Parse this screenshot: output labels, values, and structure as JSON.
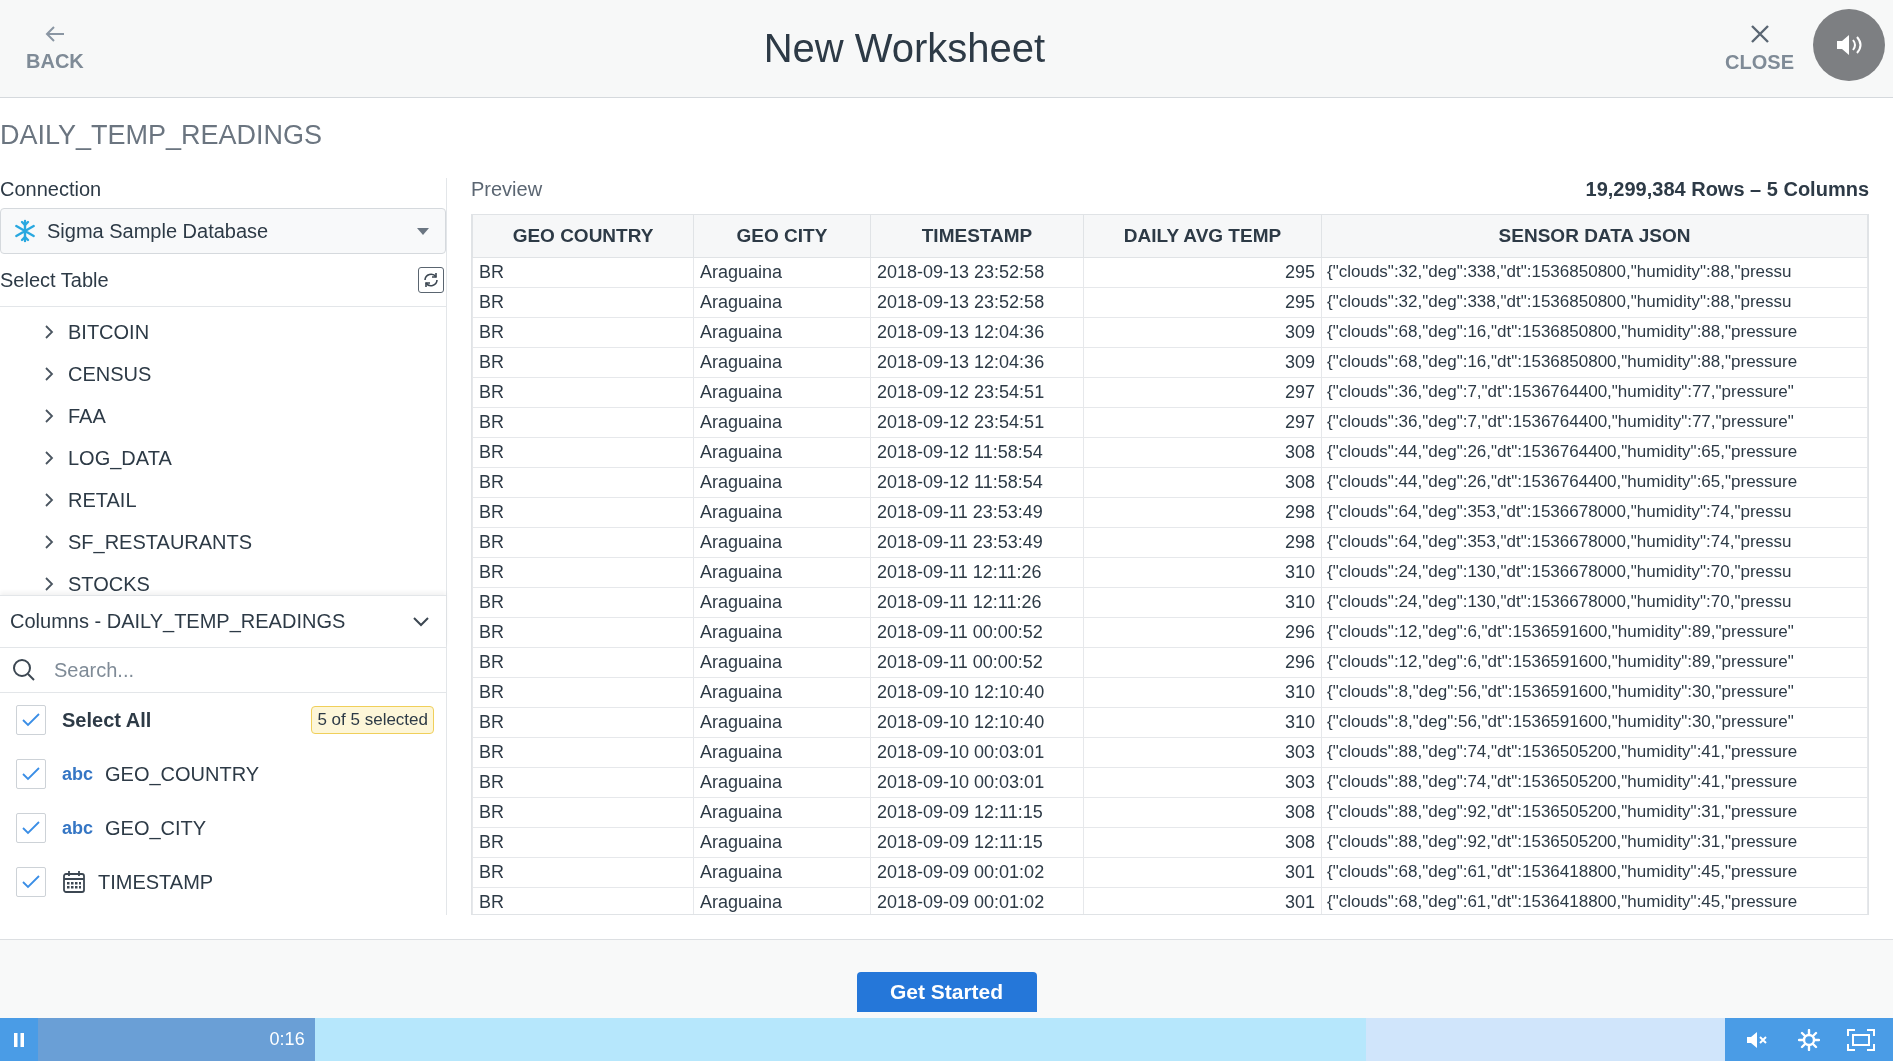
{
  "header": {
    "back_label": "BACK",
    "title": "New Worksheet",
    "close_label": "CLOSE"
  },
  "table_name": "DAILY_TEMP_READINGS",
  "connection": {
    "label": "Connection",
    "value": "Sigma Sample Database"
  },
  "select_table": {
    "label": "Select Table",
    "items": [
      {
        "label": "BITCOIN",
        "expanded": false
      },
      {
        "label": "CENSUS",
        "expanded": false
      },
      {
        "label": "FAA",
        "expanded": false
      },
      {
        "label": "LOG_DATA",
        "expanded": false
      },
      {
        "label": "RETAIL",
        "expanded": false
      },
      {
        "label": "SF_RESTAURANTS",
        "expanded": false
      },
      {
        "label": "STOCKS",
        "expanded": false
      }
    ]
  },
  "columns_panel": {
    "title": "Columns - DAILY_TEMP_READINGS",
    "expanded": true,
    "search": {
      "placeholder": "Search..."
    },
    "select_all": {
      "label": "Select All",
      "checked": true,
      "badge": "5 of 5 selected"
    },
    "items": [
      {
        "kind": "text",
        "type_label": "abc",
        "label": "GEO_COUNTRY",
        "checked": true
      },
      {
        "kind": "text",
        "type_label": "abc",
        "label": "GEO_CITY",
        "checked": true
      },
      {
        "kind": "datetime",
        "label": "TIMESTAMP",
        "checked": true
      }
    ]
  },
  "preview": {
    "label": "Preview",
    "summary": "19,299,384 Rows – 5 Columns",
    "columns": [
      "GEO COUNTRY",
      "GEO CITY",
      "TIMESTAMP",
      "DAILY AVG TEMP",
      "SENSOR DATA JSON"
    ],
    "rows": [
      [
        "BR",
        "Araguaina",
        "2018-09-13 23:52:58",
        "295",
        "{\"clouds\":32,\"deg\":338,\"dt\":1536850800,\"humidity\":88,\"pressu"
      ],
      [
        "BR",
        "Araguaina",
        "2018-09-13 23:52:58",
        "295",
        "{\"clouds\":32,\"deg\":338,\"dt\":1536850800,\"humidity\":88,\"pressu"
      ],
      [
        "BR",
        "Araguaina",
        "2018-09-13 12:04:36",
        "309",
        "{\"clouds\":68,\"deg\":16,\"dt\":1536850800,\"humidity\":88,\"pressure"
      ],
      [
        "BR",
        "Araguaina",
        "2018-09-13 12:04:36",
        "309",
        "{\"clouds\":68,\"deg\":16,\"dt\":1536850800,\"humidity\":88,\"pressure"
      ],
      [
        "BR",
        "Araguaina",
        "2018-09-12 23:54:51",
        "297",
        "{\"clouds\":36,\"deg\":7,\"dt\":1536764400,\"humidity\":77,\"pressure\""
      ],
      [
        "BR",
        "Araguaina",
        "2018-09-12 23:54:51",
        "297",
        "{\"clouds\":36,\"deg\":7,\"dt\":1536764400,\"humidity\":77,\"pressure\""
      ],
      [
        "BR",
        "Araguaina",
        "2018-09-12 11:58:54",
        "308",
        "{\"clouds\":44,\"deg\":26,\"dt\":1536764400,\"humidity\":65,\"pressure"
      ],
      [
        "BR",
        "Araguaina",
        "2018-09-12 11:58:54",
        "308",
        "{\"clouds\":44,\"deg\":26,\"dt\":1536764400,\"humidity\":65,\"pressure"
      ],
      [
        "BR",
        "Araguaina",
        "2018-09-11 23:53:49",
        "298",
        "{\"clouds\":64,\"deg\":353,\"dt\":1536678000,\"humidity\":74,\"pressu"
      ],
      [
        "BR",
        "Araguaina",
        "2018-09-11 23:53:49",
        "298",
        "{\"clouds\":64,\"deg\":353,\"dt\":1536678000,\"humidity\":74,\"pressu"
      ],
      [
        "BR",
        "Araguaina",
        "2018-09-11 12:11:26",
        "310",
        "{\"clouds\":24,\"deg\":130,\"dt\":1536678000,\"humidity\":70,\"pressu"
      ],
      [
        "BR",
        "Araguaina",
        "2018-09-11 12:11:26",
        "310",
        "{\"clouds\":24,\"deg\":130,\"dt\":1536678000,\"humidity\":70,\"pressu"
      ],
      [
        "BR",
        "Araguaina",
        "2018-09-11 00:00:52",
        "296",
        "{\"clouds\":12,\"deg\":6,\"dt\":1536591600,\"humidity\":89,\"pressure\""
      ],
      [
        "BR",
        "Araguaina",
        "2018-09-11 00:00:52",
        "296",
        "{\"clouds\":12,\"deg\":6,\"dt\":1536591600,\"humidity\":89,\"pressure\""
      ],
      [
        "BR",
        "Araguaina",
        "2018-09-10 12:10:40",
        "310",
        "{\"clouds\":8,\"deg\":56,\"dt\":1536591600,\"humidity\":30,\"pressure\""
      ],
      [
        "BR",
        "Araguaina",
        "2018-09-10 12:10:40",
        "310",
        "{\"clouds\":8,\"deg\":56,\"dt\":1536591600,\"humidity\":30,\"pressure\""
      ],
      [
        "BR",
        "Araguaina",
        "2018-09-10 00:03:01",
        "303",
        "{\"clouds\":88,\"deg\":74,\"dt\":1536505200,\"humidity\":41,\"pressure"
      ],
      [
        "BR",
        "Araguaina",
        "2018-09-10 00:03:01",
        "303",
        "{\"clouds\":88,\"deg\":74,\"dt\":1536505200,\"humidity\":41,\"pressure"
      ],
      [
        "BR",
        "Araguaina",
        "2018-09-09 12:11:15",
        "308",
        "{\"clouds\":88,\"deg\":92,\"dt\":1536505200,\"humidity\":31,\"pressure"
      ],
      [
        "BR",
        "Araguaina",
        "2018-09-09 12:11:15",
        "308",
        "{\"clouds\":88,\"deg\":92,\"dt\":1536505200,\"humidity\":31,\"pressure"
      ],
      [
        "BR",
        "Araguaina",
        "2018-09-09 00:01:02",
        "301",
        "{\"clouds\":68,\"deg\":61,\"dt\":1536418800,\"humidity\":45,\"pressure"
      ],
      [
        "BR",
        "Araguaina",
        "2018-09-09 00:01:02",
        "301",
        "{\"clouds\":68,\"deg\":61,\"dt\":1536418800,\"humidity\":45,\"pressure"
      ]
    ]
  },
  "get_started": "Get Started",
  "player": {
    "time": "0:16",
    "progress": {
      "level": 0.164
    },
    "buffer": {
      "level": 0.787
    },
    "muted": true
  }
}
